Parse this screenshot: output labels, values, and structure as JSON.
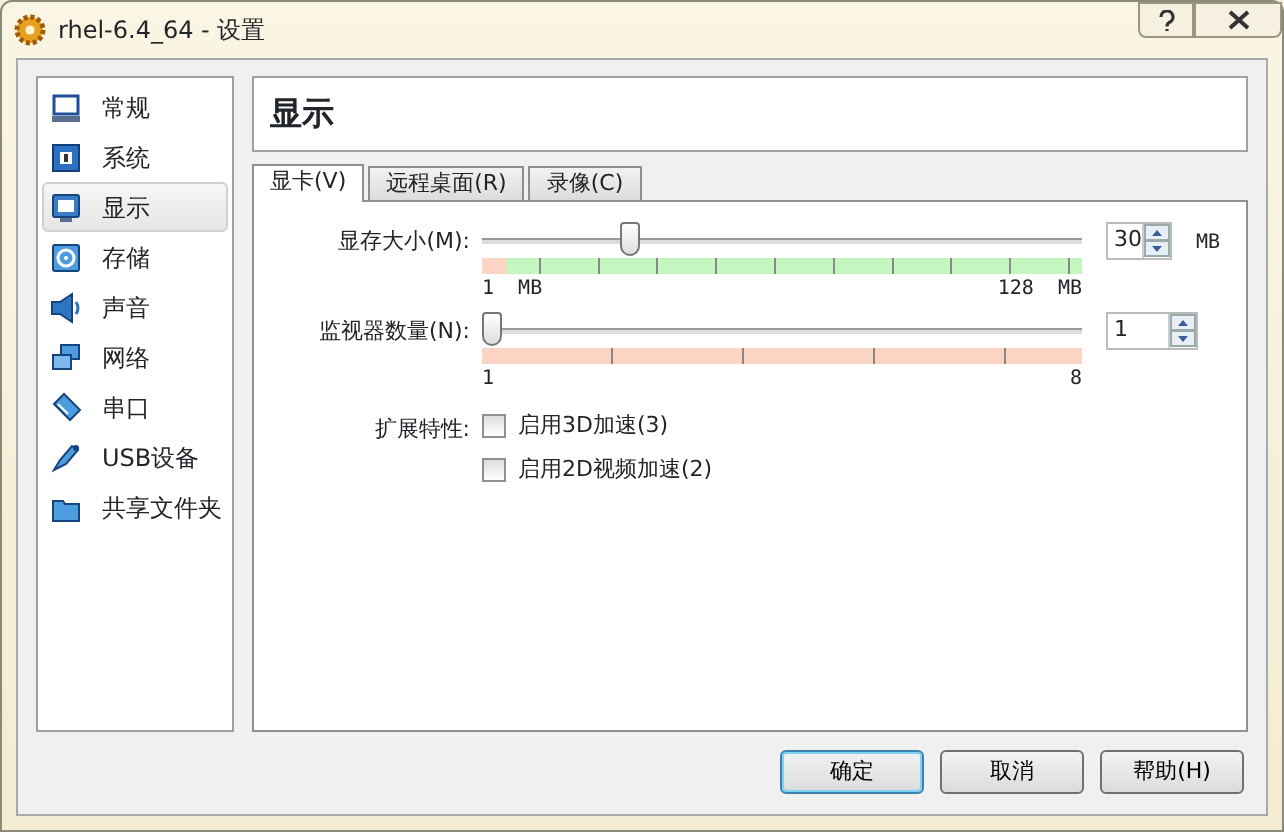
{
  "window": {
    "title": "rhel-6.4_64 - 设置"
  },
  "sidebar": {
    "items": [
      {
        "label": "常规",
        "selected": false
      },
      {
        "label": "系统",
        "selected": false
      },
      {
        "label": "显示",
        "selected": true
      },
      {
        "label": "存储",
        "selected": false
      },
      {
        "label": "声音",
        "selected": false
      },
      {
        "label": "网络",
        "selected": false
      },
      {
        "label": "串口",
        "selected": false
      },
      {
        "label": "USB设备",
        "selected": false
      },
      {
        "label": "共享文件夹",
        "selected": false
      }
    ]
  },
  "page_title": "显示",
  "tabs": [
    {
      "label": "显卡(V)",
      "selected": true
    },
    {
      "label": "远程桌面(R)",
      "selected": false
    },
    {
      "label": "录像(C)",
      "selected": false
    }
  ],
  "sliders": [
    {
      "label": "显存大小(M):",
      "level": 0.23,
      "min_label": "1  MB",
      "max_label": "128  MB",
      "value": "30",
      "unit": "MB"
    },
    {
      "label": "监视器数量(N):",
      "level": 0,
      "min_label": "1",
      "max_label": "8",
      "value": "1"
    }
  ],
  "features": {
    "label": "扩展特性:",
    "options": [
      {
        "label": "启用3D加速(3)",
        "checked": false
      },
      {
        "label": "启用2D视频加速(2)",
        "checked": false
      }
    ]
  },
  "buttons": [
    {
      "label": "确定",
      "default": true
    },
    {
      "label": "取消",
      "default": false
    },
    {
      "label": "帮助(H)",
      "default": false
    }
  ]
}
